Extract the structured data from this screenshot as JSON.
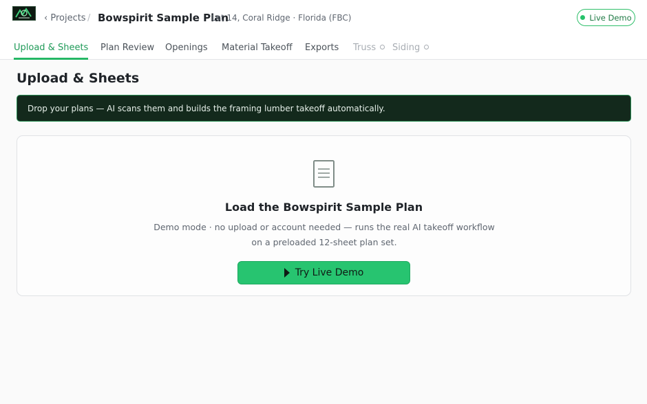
{
  "header": {
    "back_label": "‹ Projects",
    "separator": "/",
    "project_name": "Bowspirit Sample Plan",
    "project_meta": "Lot 14, Coral Ridge · Florida (FBC)",
    "live_demo_label": "Live Demo"
  },
  "tabs": [
    {
      "label": "Upload & Sheets",
      "state": "active"
    },
    {
      "label": "Plan Review",
      "state": "enabled"
    },
    {
      "label": "Openings",
      "state": "enabled"
    },
    {
      "label": "Material Takeoff",
      "state": "enabled"
    },
    {
      "label": "Exports",
      "state": "enabled"
    },
    {
      "label": "Truss",
      "state": "disabled"
    },
    {
      "label": "Siding",
      "state": "disabled"
    }
  ],
  "main": {
    "heading": "Upload & Sheets",
    "banner_text": "Drop your plans — AI scans them and builds the framing lumber takeoff automatically.",
    "card": {
      "icon": "document-icon",
      "title": "Load the Bowspirit Sample Plan",
      "desc_line1": "Demo mode · no upload or account needed — runs the real AI takeoff workflow",
      "desc_line2": "on a preloaded 12-sheet plan set.",
      "button_label": "Try Live Demo"
    }
  },
  "colors": {
    "accent": "#25b765",
    "banner_bg": "#13291c",
    "button_bg": "#27c470"
  }
}
